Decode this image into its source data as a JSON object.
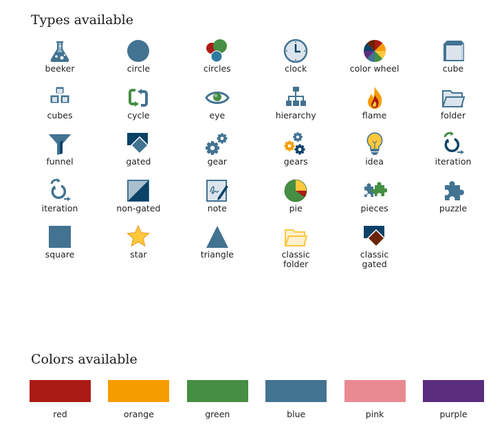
{
  "types_section": {
    "title": "Types available",
    "items": [
      {
        "label": "beeker",
        "icon": "beaker-icon"
      },
      {
        "label": "circle",
        "icon": "circle-icon"
      },
      {
        "label": "circles",
        "icon": "circles-icon"
      },
      {
        "label": "clock",
        "icon": "clock-icon"
      },
      {
        "label": "color wheel",
        "icon": "color-wheel-icon"
      },
      {
        "label": "cube",
        "icon": "cube-icon"
      },
      {
        "label": "cubes",
        "icon": "cubes-icon"
      },
      {
        "label": "cycle",
        "icon": "cycle-icon"
      },
      {
        "label": "eye",
        "icon": "eye-icon"
      },
      {
        "label": "hierarchy",
        "icon": "hierarchy-icon"
      },
      {
        "label": "flame",
        "icon": "flame-icon"
      },
      {
        "label": "folder",
        "icon": "folder-icon"
      },
      {
        "label": "funnel",
        "icon": "funnel-icon"
      },
      {
        "label": "gated",
        "icon": "gated-icon"
      },
      {
        "label": "gear",
        "icon": "gear-icon"
      },
      {
        "label": "gears",
        "icon": "gears-icon"
      },
      {
        "label": "idea",
        "icon": "lightbulb-icon"
      },
      {
        "label": "iteration",
        "icon": "iteration-color-icon"
      },
      {
        "label": "iteration",
        "icon": "iteration-icon"
      },
      {
        "label": "non-gated",
        "icon": "non-gated-icon"
      },
      {
        "label": "note",
        "icon": "note-icon"
      },
      {
        "label": "pie",
        "icon": "pie-icon"
      },
      {
        "label": "pieces",
        "icon": "pieces-icon"
      },
      {
        "label": "puzzle",
        "icon": "puzzle-icon"
      },
      {
        "label": "square",
        "icon": "square-icon"
      },
      {
        "label": "star",
        "icon": "star-icon"
      },
      {
        "label": "triangle",
        "icon": "triangle-icon"
      },
      {
        "label": "classic\nfolder",
        "label_lines": [
          "classic",
          "folder"
        ],
        "icon": "classic-folder-icon"
      },
      {
        "label": "classic\ngated",
        "label_lines": [
          "classic",
          "gated"
        ],
        "icon": "classic-gated-icon"
      }
    ]
  },
  "colors_section": {
    "title": "Colors available",
    "items": [
      {
        "label": "red",
        "color": "#ab1b15"
      },
      {
        "label": "orange",
        "color": "#f59d00"
      },
      {
        "label": "green",
        "color": "#458e42"
      },
      {
        "label": "blue",
        "color": "#427391"
      },
      {
        "label": "pink",
        "color": "#e98a92"
      },
      {
        "label": "purple",
        "color": "#5a2d7e"
      }
    ]
  },
  "palette": {
    "icon_blue": "#427391",
    "dark_blue": "#0b4266",
    "light_fill": "#dbe4ec",
    "green": "#458e42",
    "red": "#ab1b15",
    "yellow": "#fdc83d",
    "brown": "#6b2305"
  }
}
